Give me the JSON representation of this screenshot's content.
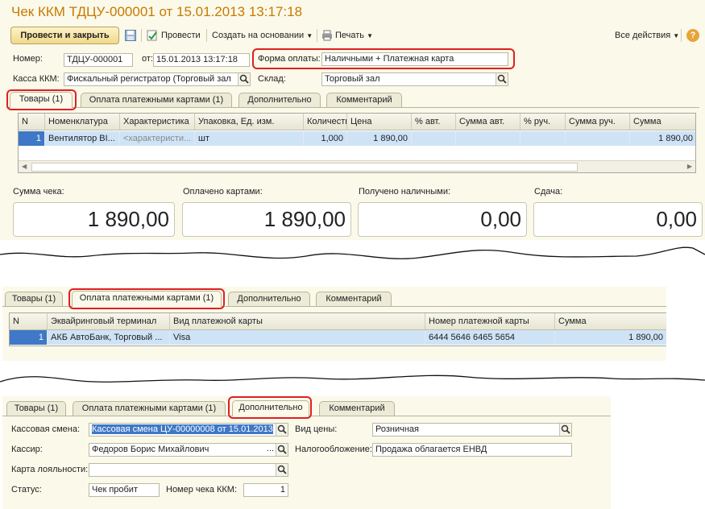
{
  "window": {
    "title": "Чек ККМ ТДЦУ-000001 от 15.01.2013 13:17:18"
  },
  "toolbar": {
    "post_close": "Провести и закрыть",
    "post": "Провести",
    "create_based": "Создать на основании",
    "print": "Печать",
    "all_actions": "Все действия",
    "help": "?"
  },
  "header": {
    "number_label": "Номер:",
    "number_value": "ТДЦУ-000001",
    "date_label": "от:",
    "date_value": "15.01.2013 13:17:18",
    "payment_label": "Форма оплаты:",
    "payment_value": "Наличными + Платежная карта",
    "cashbox_label": "Касса ККМ:",
    "cashbox_value": "Фискальный регистратор (Торговый зал",
    "warehouse_label": "Склад:",
    "warehouse_value": "Торговый зал"
  },
  "tabs": [
    "Товары (1)",
    "Оплата платежными картами (1)",
    "Дополнительно",
    "Комментарий"
  ],
  "goods_table": {
    "columns": [
      "N",
      "Номенклатура",
      "Характеристика",
      "Упаковка, Ед. изм.",
      "Количество",
      "Цена",
      "% авт.",
      "Сумма авт.",
      "% руч.",
      "Сумма руч.",
      "Сумма"
    ],
    "rows": [
      {
        "n": "1",
        "item": "Вентилятор BI...",
        "char": "<характеристи...",
        "unit": "шт",
        "qty": "1,000",
        "price": "1 890,00",
        "auto_pct": "",
        "auto_sum": "",
        "man_pct": "",
        "man_sum": "",
        "sum": "1 890,00"
      }
    ]
  },
  "totals": {
    "check_sum_label": "Сумма чека:",
    "check_sum": "1 890,00",
    "cards_label": "Оплачено картами:",
    "cards": "1 890,00",
    "cash_label": "Получено наличными:",
    "cash": "0,00",
    "change_label": "Сдача:",
    "change": "0,00"
  },
  "cards_table": {
    "columns": [
      "N",
      "Эквайринговый терминал",
      "Вид платежной карты",
      "Номер платежной карты",
      "Сумма"
    ],
    "rows": [
      {
        "n": "1",
        "terminal": "АКБ АвтоБанк, Торговый ...",
        "card_type": "Visa",
        "card_number": "6444 5646 6465 5654",
        "sum": "1 890,00"
      }
    ]
  },
  "additional": {
    "shift_label": "Кассовая смена:",
    "shift_value": "Кассовая смена ЦУ-00000008 от 15.01.2013",
    "cashier_label": "Кассир:",
    "cashier_value": "Федоров Борис Михайлович",
    "loyalty_label": "Карта лояльности:",
    "loyalty_value": "",
    "status_label": "Статус:",
    "status_value": "Чек пробит",
    "check_no_label": "Номер чека ККМ:",
    "check_no_value": "1",
    "price_type_label": "Вид цены:",
    "price_type_value": "Розничная",
    "tax_label": "Налогообложение:",
    "tax_value": "Продажа облагается ЕНВД"
  },
  "colors": {
    "title": "#c77a00",
    "highlight_box": "#e02020",
    "selected_row": "#cfe3f7",
    "panel": "#fbf9ea"
  }
}
